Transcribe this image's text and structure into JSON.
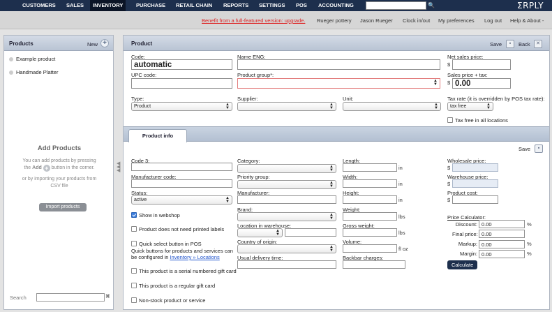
{
  "topnav": {
    "items": [
      "CUSTOMERS",
      "SALES",
      "INVENTORY",
      "PURCHASE",
      "RETAIL CHAIN",
      "REPORTS",
      "SETTINGS",
      "POS",
      "ACCOUNTING"
    ],
    "logo": "ΣRPLY"
  },
  "subbar": {
    "upgrade": "Benefit from a full-featured version: upgrade.",
    "company": "Rueger pottery",
    "user": "Jason Rueger",
    "clock": "Clock in/out",
    "preferences": "My preferences",
    "logout": "Log out",
    "help": "Help & About -"
  },
  "left": {
    "title": "Products",
    "new_label": "New",
    "products": [
      "Example product",
      "Handmade Platter"
    ],
    "add_title": "Add Products",
    "add_line1": "You can add products by pressing",
    "add_line2a": "the ",
    "add_line2b": "Add",
    "add_line2c": " button in the corner.",
    "add_line3": "or by importing your products from",
    "add_line4": "CSV file",
    "import_label": "Import products",
    "search_label": "Search"
  },
  "product": {
    "title": "Product",
    "save_label": "Save",
    "back_label": "Back",
    "code_label": "Code:",
    "code_value": "automatic",
    "upc_label": "UPC code:",
    "name_label": "Name ENG:",
    "group_label": "Product group*:",
    "net_price_label": "Net sales price:",
    "currency": "$",
    "price_tax_label": "Sales price + tax:",
    "price_tax_value": "0.00",
    "type_label": "Type:",
    "type_value": "Product",
    "supplier_label": "Supplier:",
    "unit_label": "Unit:",
    "tax_rate_label": "Tax rate (it is overridden by POS tax rate):",
    "tax_rate_value": "tax free",
    "tax_free_all": "Tax free in all locations"
  },
  "info": {
    "tab_label": "Product info",
    "save_label": "Save",
    "code3": "Code 3:",
    "manufacturer_code": "Manufacturer code:",
    "status_label": "Status:",
    "status_value": "active",
    "show_webshop": "Show in webshop",
    "no_printed_labels": "Product does not need printed labels",
    "quick_select": "Quick select button in POS",
    "quick_note1": "Quick buttons for products and services can",
    "quick_note2": "be configured in ",
    "quick_link": "Inventory » Locations",
    "serial_gift": "This product is a serial numbered gift card",
    "regular_gift": "This product is a regular gift card",
    "non_stock": "Non-stock product or service",
    "category": "Category:",
    "priority_group": "Priority group:",
    "manufacturer": "Manufacturer:",
    "brand": "Brand:",
    "location": "Location in warehouse:",
    "country": "Country of origin:",
    "delivery": "Usual delivery time:",
    "length": "Length:",
    "width": "Width:",
    "height": "Height:",
    "weight": "Weight:",
    "gross_weight": "Gross weight:",
    "volume": "Volume:",
    "backbar": "Backbar charges:",
    "unit_in": "in",
    "unit_lbs": "lbs",
    "unit_floz": "fl oz",
    "wholesale": "Wholesale price:",
    "warehouse_price": "Warehouse price:",
    "product_cost": "Product cost:",
    "calc_title": "Price Calculator:",
    "discount": "Discount:",
    "final_price": "Final price:",
    "markup": "Markup:",
    "margin": "Margin:",
    "zero": "0.00",
    "percent": "%",
    "calculate": "Calculate"
  }
}
